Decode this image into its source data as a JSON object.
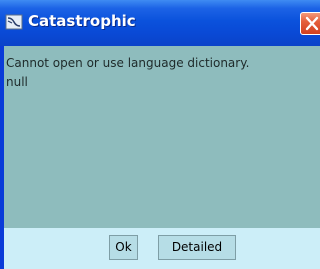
{
  "dialog": {
    "title": "Catastrophic",
    "title_icon": "java-cup-icon",
    "close_icon": "close-icon",
    "message_lines": [
      "Cannot open or use language dictionary.",
      "null"
    ],
    "buttons": {
      "ok_label": "Ok",
      "detailed_label": "Detailed"
    }
  },
  "colors": {
    "titlebar": "#0b52dc",
    "content_bg": "#8ebcbd",
    "button_bar_bg": "#cceef8",
    "close_button": "#e5603d"
  }
}
